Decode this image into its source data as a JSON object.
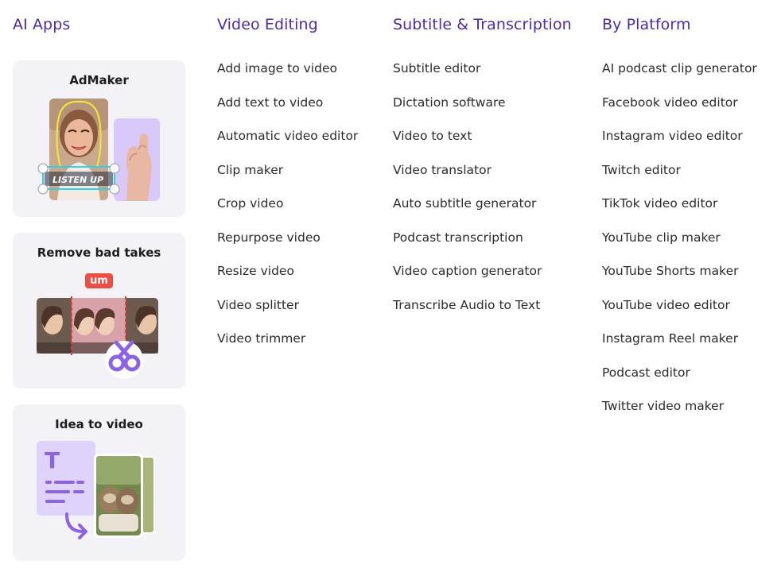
{
  "ai_apps": {
    "heading": "AI Apps",
    "cards": [
      {
        "title": "AdMaker",
        "caption": "LISTEN UP"
      },
      {
        "title": "Remove bad takes",
        "badge": "um"
      },
      {
        "title": "Idea to video",
        "glyph": "T"
      }
    ]
  },
  "video_editing": {
    "heading": "Video Editing",
    "items": [
      "Add image to video",
      "Add text to video",
      "Automatic video editor",
      "Clip maker",
      "Crop video",
      "Repurpose video",
      "Resize video",
      "Video splitter",
      "Video trimmer"
    ]
  },
  "subtitle_transcription": {
    "heading": "Subtitle & Transcription",
    "items": [
      "Subtitle editor",
      "Dictation software",
      "Video to text",
      "Video translator",
      "Auto subtitle generator",
      "Podcast transcription",
      "Video caption generator",
      "Transcribe Audio to Text"
    ]
  },
  "by_platform": {
    "heading": "By Platform",
    "items": [
      "AI podcast clip generator",
      "Facebook video editor",
      "Instagram video editor",
      "Twitch editor",
      "TikTok video editor",
      "YouTube clip maker",
      "YouTube Shorts maker",
      "YouTube video editor",
      "Instagram Reel maker",
      "Podcast editor",
      "Twitter video maker"
    ]
  },
  "colors": {
    "heading": "#4b2ba8",
    "accent_purple": "#8d63e6",
    "badge_red": "#ec4e43",
    "card_bg": "#f2f2f7"
  }
}
